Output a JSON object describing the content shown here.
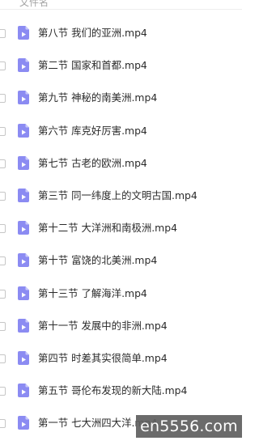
{
  "header": {
    "column_label": "文件名"
  },
  "files": [
    {
      "name": "第八节 我们的亚洲.mp4",
      "icon": "video-file-icon"
    },
    {
      "name": "第二节 国家和首都.mp4",
      "icon": "video-file-icon"
    },
    {
      "name": "第九节 神秘的南美洲.mp4",
      "icon": "video-file-icon"
    },
    {
      "name": "第六节 库克好厉害.mp4",
      "icon": "video-file-icon"
    },
    {
      "name": "第七节 古老的欧洲.mp4",
      "icon": "video-file-icon"
    },
    {
      "name": "第三节 同一纬度上的文明古国.mp4",
      "icon": "video-file-icon"
    },
    {
      "name": "第十二节 大洋洲和南极洲.mp4",
      "icon": "video-file-icon"
    },
    {
      "name": "第十节 富饶的北美洲.mp4",
      "icon": "video-file-icon"
    },
    {
      "name": "第十三节 了解海洋.mp4",
      "icon": "video-file-icon"
    },
    {
      "name": "第十一节 发展中的非洲.mp4",
      "icon": "video-file-icon"
    },
    {
      "name": "第四节 时差其实很简单.mp4",
      "icon": "video-file-icon"
    },
    {
      "name": "第五节 哥伦布发现的新大陆.mp4",
      "icon": "video-file-icon"
    },
    {
      "name": "第一节 七大洲四大洋.mp4",
      "icon": "video-file-icon"
    }
  ],
  "watermark": {
    "text": "en5556.com"
  },
  "colors": {
    "icon_fill": "#8b8bf2",
    "icon_fold": "#c9c9fb",
    "text": "#2b2b2b",
    "header_text": "#a3a3a3"
  }
}
